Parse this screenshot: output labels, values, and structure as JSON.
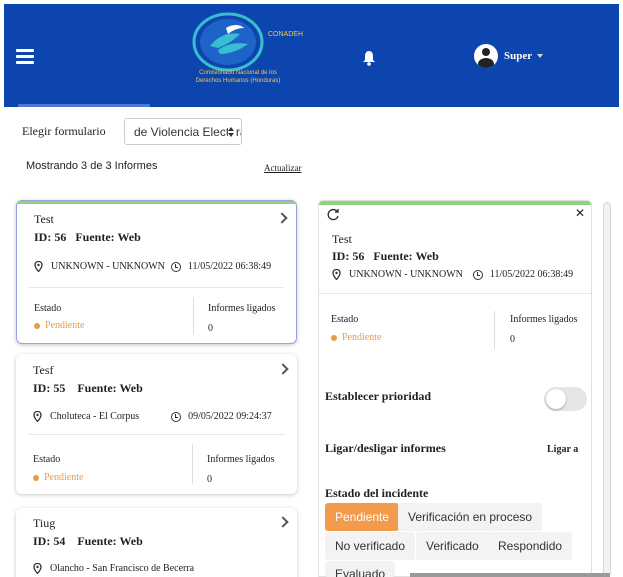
{
  "header": {
    "logo_acronym": "CONADEH",
    "logo_text": "Comisionado Nacional de los Derechos Humanos (Honduras)",
    "user_name": "Super",
    "colors": {
      "header_bg": "#0c45ad",
      "accent": "#f29b4c",
      "success_bar": "#8ed27f"
    }
  },
  "filters": {
    "form_label": "Elegir formulario",
    "form_selected": "de Violencia Electoral",
    "showing_text": "Mostrando 3 de 3 Informes",
    "refresh_label": "Actualizar"
  },
  "reports": [
    {
      "title": "Test",
      "id_label": "ID: 56",
      "source_label": "Fuente: Web",
      "location": "UNKNOWN - UNKNOWN",
      "datetime": "11/05/2022 06:38:49",
      "status_label": "Estado",
      "status_value": "Pendiente",
      "linked_label": "Informes ligados",
      "linked_count": "0"
    },
    {
      "title": "Tesf",
      "id_label": "ID: 55",
      "source_label": "Fuente: Web",
      "location": "Choluteca - El Corpus",
      "datetime": "09/05/2022 09:24:37",
      "status_label": "Estado",
      "status_value": "Pendiente",
      "linked_label": "Informes ligados",
      "linked_count": "0"
    },
    {
      "title": "Tiug",
      "id_label": "ID: 54",
      "source_label": "Fuente: Web",
      "location": "Olancho - San Francisco de Becerra"
    }
  ],
  "detail": {
    "title": "Test",
    "id_label": "ID: 56",
    "source_label": "Fuente: Web",
    "location": "UNKNOWN - UNKNOWN",
    "datetime": "11/05/2022 06:38:49",
    "status_label": "Estado",
    "status_value": "Pendiente",
    "linked_label": "Informes ligados",
    "linked_count": "0",
    "priority_label": "Establecer prioridad",
    "link_label": "Ligar/desligar informes",
    "link_action": "Ligar a",
    "incident_state_label": "Estado del incidente",
    "incident_states": [
      "Pendiente",
      "Verificación en proceso",
      "No verificado",
      "Verificado",
      "Respondido",
      "Evaluado"
    ],
    "incident_state_selected": "Pendiente"
  }
}
